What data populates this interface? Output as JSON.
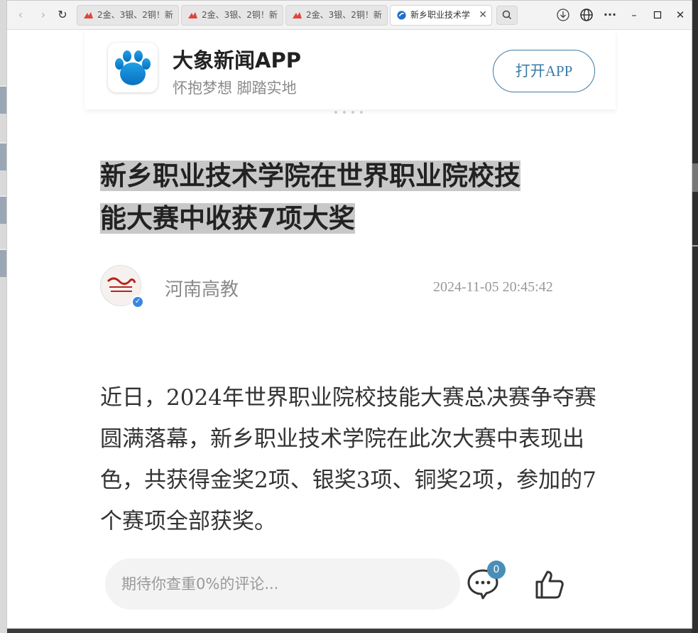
{
  "browser": {
    "tabs": [
      {
        "label": "2金、3银、2铜！新"
      },
      {
        "label": "2金、3银、2铜！新"
      },
      {
        "label": "2金、3银、2铜！新"
      },
      {
        "label": "新乡职业技术学"
      }
    ],
    "close_tab_glyph": "✕",
    "nav": {
      "back": "‹",
      "forward": "›",
      "reload": "↻"
    },
    "controls": {
      "download": "⇩",
      "globe": "⊕",
      "more": "···",
      "minimize": "–",
      "maximize": "☐",
      "close": "✕"
    }
  },
  "banner": {
    "app_name": "大象新闻APP",
    "slogan": "怀抱梦想 脚踏实地",
    "open_button": "打开APP"
  },
  "article": {
    "title_line1": "新乡职业技术学院在世界职业院校技",
    "title_line2": "能大赛中收获7项大奖",
    "author": "河南高教",
    "published": "2024-11-05 20:45:42",
    "body": "近日，2024年世界职业院校技能大赛总决赛争夺赛圆满落幕，新乡职业技术学院在此次大赛中表现出色，共获得金奖2项、银奖3项、铜奖2项，参加的7个赛项全部获奖。"
  },
  "footer": {
    "comment_placeholder": "期待你查重0%的评论...",
    "comment_count": "0"
  },
  "colors": {
    "accent": "#3c7ca8",
    "badge": "#4a8db7",
    "title_highlight": "#c8c8c8",
    "verified": "#3a86e0"
  }
}
